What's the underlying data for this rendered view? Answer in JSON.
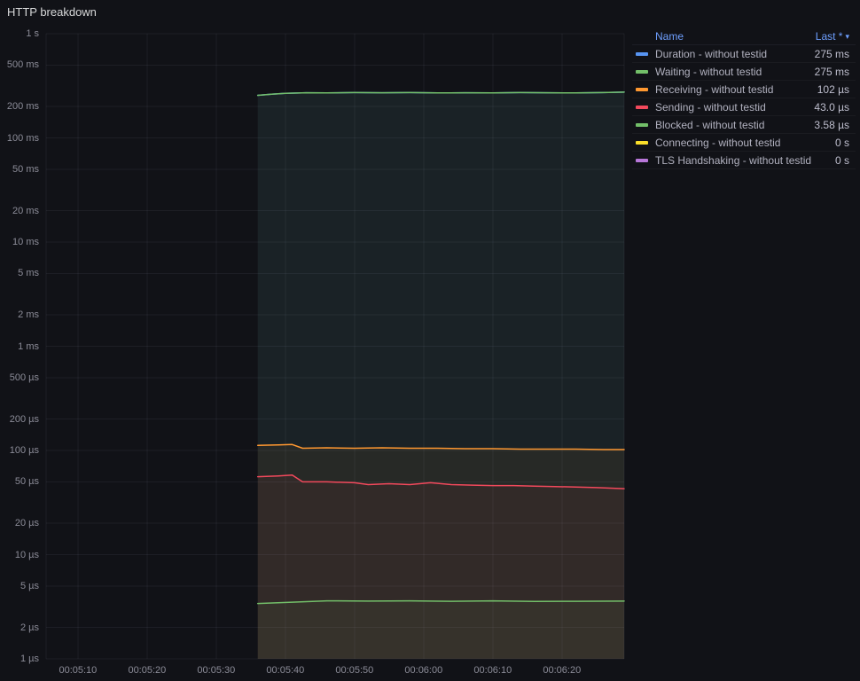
{
  "panel": {
    "title": "HTTP breakdown"
  },
  "legend": {
    "name_header": "Name",
    "value_header": "Last *",
    "sort_icon": "▾",
    "rows": [
      {
        "label": "Duration - without testid",
        "value": "275 ms",
        "color": "#5794F2"
      },
      {
        "label": "Waiting - without testid",
        "value": "275 ms",
        "color": "#73BF69"
      },
      {
        "label": "Receiving - without testid",
        "value": "102 µs",
        "color": "#FF9830"
      },
      {
        "label": "Sending - without testid",
        "value": "43.0 µs",
        "color": "#F2495C"
      },
      {
        "label": "Blocked - without testid",
        "value": "3.58 µs",
        "color": "#73BF69"
      },
      {
        "label": "Connecting - without testid",
        "value": "0 s",
        "color": "#FADE2A"
      },
      {
        "label": "TLS Handshaking - without testid",
        "value": "0 s",
        "color": "#B877D9"
      }
    ]
  },
  "chart_data": {
    "type": "line",
    "title": "HTTP breakdown",
    "y_scale": "log10",
    "y_unit": "seconds",
    "ylim": [
      1e-06,
      1
    ],
    "grid": true,
    "legend_position": "right-table",
    "x_range_seconds": [
      305.4,
      389
    ],
    "y_ticks": [
      {
        "v": 1,
        "label": "1 s"
      },
      {
        "v": 0.5,
        "label": "500 ms"
      },
      {
        "v": 0.2,
        "label": "200 ms"
      },
      {
        "v": 0.1,
        "label": "100 ms"
      },
      {
        "v": 0.05,
        "label": "50 ms"
      },
      {
        "v": 0.02,
        "label": "20 ms"
      },
      {
        "v": 0.01,
        "label": "10 ms"
      },
      {
        "v": 0.005,
        "label": "5 ms"
      },
      {
        "v": 0.002,
        "label": "2 ms"
      },
      {
        "v": 0.001,
        "label": "1 ms"
      },
      {
        "v": 0.0005,
        "label": "500 µs"
      },
      {
        "v": 0.0002,
        "label": "200 µs"
      },
      {
        "v": 0.0001,
        "label": "100 µs"
      },
      {
        "v": 5e-05,
        "label": "50 µs"
      },
      {
        "v": 2e-05,
        "label": "20 µs"
      },
      {
        "v": 1e-05,
        "label": "10 µs"
      },
      {
        "v": 5e-06,
        "label": "5 µs"
      },
      {
        "v": 2e-06,
        "label": "2 µs"
      },
      {
        "v": 1e-06,
        "label": "1 µs"
      }
    ],
    "x_ticks": [
      {
        "t": 310,
        "label": "00:05:10"
      },
      {
        "t": 320,
        "label": "00:05:20"
      },
      {
        "t": 330,
        "label": "00:05:30"
      },
      {
        "t": 340,
        "label": "00:05:40"
      },
      {
        "t": 350,
        "label": "00:05:50"
      },
      {
        "t": 360,
        "label": "00:06:00"
      },
      {
        "t": 370,
        "label": "00:06:10"
      },
      {
        "t": 380,
        "label": "00:06:20"
      }
    ],
    "series": [
      {
        "id": "duration",
        "name": "Duration - without testid",
        "color": "#5794F2",
        "last": "275 ms",
        "points": [
          [
            336,
            0.256
          ],
          [
            338,
            0.263
          ],
          [
            340,
            0.268
          ],
          [
            343,
            0.271
          ],
          [
            346,
            0.27
          ],
          [
            350,
            0.272
          ],
          [
            354,
            0.271
          ],
          [
            358,
            0.272
          ],
          [
            362,
            0.27
          ],
          [
            366,
            0.271
          ],
          [
            370,
            0.27
          ],
          [
            374,
            0.272
          ],
          [
            378,
            0.271
          ],
          [
            382,
            0.27
          ],
          [
            386,
            0.272
          ],
          [
            389,
            0.275
          ]
        ]
      },
      {
        "id": "waiting",
        "name": "Waiting - without testid",
        "color": "#73BF69",
        "last": "275 ms",
        "points": [
          [
            336,
            0.256
          ],
          [
            338,
            0.263
          ],
          [
            340,
            0.268
          ],
          [
            343,
            0.271
          ],
          [
            346,
            0.27
          ],
          [
            350,
            0.272
          ],
          [
            354,
            0.271
          ],
          [
            358,
            0.272
          ],
          [
            362,
            0.27
          ],
          [
            366,
            0.271
          ],
          [
            370,
            0.27
          ],
          [
            374,
            0.272
          ],
          [
            378,
            0.271
          ],
          [
            382,
            0.27
          ],
          [
            386,
            0.272
          ],
          [
            389,
            0.275
          ]
        ]
      },
      {
        "id": "receiving",
        "name": "Receiving - without testid",
        "color": "#FF9830",
        "last": "102 µs",
        "points": [
          [
            336,
            0.000112
          ],
          [
            339,
            0.000113
          ],
          [
            341,
            0.000114
          ],
          [
            342.5,
            0.000105
          ],
          [
            346,
            0.000106
          ],
          [
            350,
            0.000105
          ],
          [
            354,
            0.000106
          ],
          [
            358,
            0.000105
          ],
          [
            362,
            0.000105
          ],
          [
            366,
            0.000104
          ],
          [
            370,
            0.000104
          ],
          [
            374,
            0.000103
          ],
          [
            378,
            0.000103
          ],
          [
            382,
            0.000103
          ],
          [
            386,
            0.000102
          ],
          [
            389,
            0.000102
          ]
        ]
      },
      {
        "id": "sending",
        "name": "Sending - without testid",
        "color": "#F2495C",
        "last": "43.0 µs",
        "points": [
          [
            336,
            5.6e-05
          ],
          [
            339,
            5.7e-05
          ],
          [
            341,
            5.8e-05
          ],
          [
            342.5,
            5e-05
          ],
          [
            346,
            5e-05
          ],
          [
            350,
            4.9e-05
          ],
          [
            352,
            4.7e-05
          ],
          [
            355,
            4.8e-05
          ],
          [
            358,
            4.7e-05
          ],
          [
            361,
            4.9e-05
          ],
          [
            364,
            4.7e-05
          ],
          [
            367,
            4.65e-05
          ],
          [
            370,
            4.6e-05
          ],
          [
            373,
            4.6e-05
          ],
          [
            376,
            4.55e-05
          ],
          [
            379,
            4.5e-05
          ],
          [
            382,
            4.45e-05
          ],
          [
            385,
            4.4e-05
          ],
          [
            389,
            4.3e-05
          ]
        ]
      },
      {
        "id": "blocked",
        "name": "Blocked - without testid",
        "color": "#73BF69",
        "last": "3.58 µs",
        "points": [
          [
            336,
            3.4e-06
          ],
          [
            341,
            3.5e-06
          ],
          [
            346,
            3.6e-06
          ],
          [
            352,
            3.58e-06
          ],
          [
            358,
            3.6e-06
          ],
          [
            364,
            3.57e-06
          ],
          [
            370,
            3.6e-06
          ],
          [
            376,
            3.55e-06
          ],
          [
            382,
            3.57e-06
          ],
          [
            389,
            3.58e-06
          ]
        ]
      },
      {
        "id": "connecting",
        "name": "Connecting - without testid",
        "color": "#FADE2A",
        "last": "0 s",
        "points": []
      },
      {
        "id": "tls_handshaking",
        "name": "TLS Handshaking - without testid",
        "color": "#B877D9",
        "last": "0 s",
        "points": []
      }
    ]
  }
}
